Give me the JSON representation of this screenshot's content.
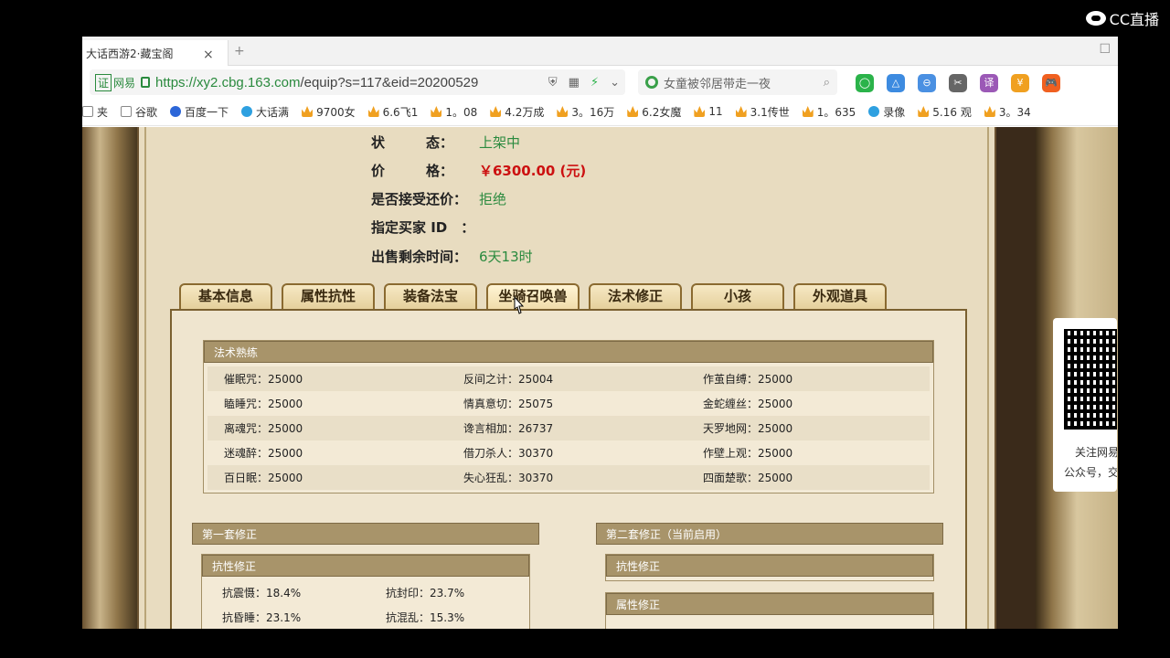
{
  "overlay": {
    "logo_text": "CC直播"
  },
  "browser": {
    "tab_title": "大话西游2·藏宝阁",
    "tab_close": "×",
    "tab_new": "+",
    "cert_label": "证",
    "cert_name": "网易",
    "url_host": "https://xy2.cbg.163.com",
    "url_rest": "/equip?s=117&eid=20200529",
    "search_text": "女童被邻居带走一夜",
    "toolbar_icons": [
      {
        "name": "green-circle-icon",
        "color": "#2bb34a",
        "label": "◯"
      },
      {
        "name": "triangle-app-icon",
        "color": "#3d8be0",
        "label": "△"
      },
      {
        "name": "minus-circle-icon",
        "color": "#4a90e2",
        "label": "⊖"
      },
      {
        "name": "scissors-icon",
        "color": "#666666",
        "label": "✂"
      },
      {
        "name": "translate-icon",
        "color": "#9b59b6",
        "label": "译"
      },
      {
        "name": "yuan-shield-icon",
        "color": "#f0a020",
        "label": "¥"
      },
      {
        "name": "game-controller-icon",
        "color": "#f06020",
        "label": "🎮"
      }
    ]
  },
  "bookmarks": [
    {
      "icon": "doc",
      "label": "夹"
    },
    {
      "icon": "doc",
      "label": "谷歌"
    },
    {
      "icon": "paw",
      "label": "百度一下"
    },
    {
      "icon": "ball",
      "label": "大话满"
    },
    {
      "icon": "crown",
      "label": "9700女"
    },
    {
      "icon": "crown",
      "label": "6.6飞1"
    },
    {
      "icon": "crown",
      "label": "1。08"
    },
    {
      "icon": "crown",
      "label": "4.2万成"
    },
    {
      "icon": "crown",
      "label": "3。16万"
    },
    {
      "icon": "crown",
      "label": "6.2女魔"
    },
    {
      "icon": "crown",
      "label": "11"
    },
    {
      "icon": "crown",
      "label": "3.1传世"
    },
    {
      "icon": "crown",
      "label": "1。635"
    },
    {
      "icon": "ball",
      "label": "录像"
    },
    {
      "icon": "crown",
      "label": "5.16 观"
    },
    {
      "icon": "crown",
      "label": "3。34"
    }
  ],
  "info": {
    "status_label": "状　　　态：",
    "status_value": "上架中",
    "price_label": "价　　　格：",
    "price_value": "￥6300.00 (元)",
    "bargain_label": "是否接受还价：",
    "bargain_value": "拒绝",
    "buyer_label": "指定买家 ID　：",
    "buyer_value": "",
    "time_label": "出售剩余时间：",
    "time_value": "6天13时"
  },
  "tabs": [
    "基本信息",
    "属性抗性",
    "装备法宝",
    "坐骑召唤兽",
    "法术修正",
    "小孩",
    "外观道具"
  ],
  "skills": {
    "title": "法术熟练",
    "rows": [
      [
        "催眠咒：25000",
        "反间之计：25004",
        "作茧自缚：25000"
      ],
      [
        "瞌睡咒：25000",
        "情真意切：25075",
        "金蛇缠丝：25000"
      ],
      [
        "离魂咒：25000",
        "谗言相加：26737",
        "天罗地网：25000"
      ],
      [
        "迷魂醉：25000",
        "借刀杀人：30370",
        "作壁上观：25000"
      ],
      [
        "百日眠：25000",
        "失心狂乱：30370",
        "四面楚歌：25000"
      ]
    ]
  },
  "set1": {
    "title": "第一套修正",
    "resist_title": "抗性修正",
    "rows": [
      [
        "抗震慑：18.4%",
        "抗封印：23.7%"
      ],
      [
        "抗昏睡：23.1%",
        "抗混乱：15.3%"
      ]
    ]
  },
  "set2": {
    "title": "第二套修正（当前启用）",
    "resist_title": "抗性修正",
    "attr_title": "属性修正"
  },
  "qr": {
    "line1": "关注网易",
    "line2": "公众号，交"
  }
}
